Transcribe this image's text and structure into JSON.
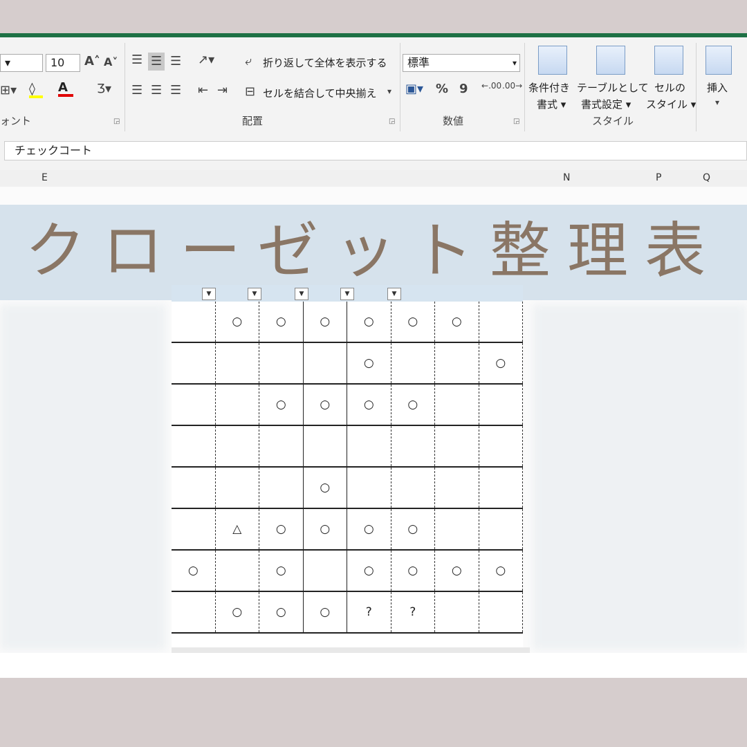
{
  "ribbon": {
    "font_size": "10",
    "grow_font": "A˄",
    "shrink_font": "A˅",
    "wrap_text": "折り返して全体を表示する",
    "merge_center": "セルを結合して中央揃え",
    "number_format": "標準",
    "percent": "%",
    "comma": "9",
    "inc_decimal": ".00",
    "dec_decimal": ".00",
    "cond_format": "条件付き\n書式",
    "cond_format_l1": "条件付き",
    "cond_format_l2": "書式 ▾",
    "table_format_l1": "テーブルとして",
    "table_format_l2": "書式設定 ▾",
    "cell_style_l1": "セルの",
    "cell_style_l2": "スタイル ▾",
    "insert": "挿入",
    "groups": {
      "font": "ォント",
      "alignment": "配置",
      "number": "数値",
      "style": "スタイル"
    }
  },
  "formula_bar": {
    "value": "チェックコート"
  },
  "columns": {
    "e": "E",
    "n": "N",
    "p": "P",
    "q": "Q"
  },
  "title": "クローゼット整理表",
  "grid": {
    "rows": [
      [
        "",
        "○",
        "○",
        "○",
        "○",
        "○",
        "○",
        ""
      ],
      [
        "",
        "",
        "",
        "",
        "○",
        "",
        "",
        "○"
      ],
      [
        "",
        "",
        "○",
        "○",
        "○",
        "○",
        "",
        ""
      ],
      [
        "",
        "",
        "",
        "",
        "",
        "",
        "",
        ""
      ],
      [
        "",
        "",
        "",
        "○",
        "",
        "",
        "",
        ""
      ],
      [
        "",
        "△",
        "○",
        "○",
        "○",
        "○",
        "",
        ""
      ],
      [
        "○",
        "",
        "○",
        "",
        "○",
        "○",
        "○",
        "○"
      ],
      [
        "",
        "○",
        "○",
        "○",
        "?",
        "?",
        "",
        ""
      ]
    ]
  },
  "colors": {
    "excel_green": "#1e7145",
    "title_brown": "#8a7665",
    "frame_mauve": "#d6cdcd"
  }
}
